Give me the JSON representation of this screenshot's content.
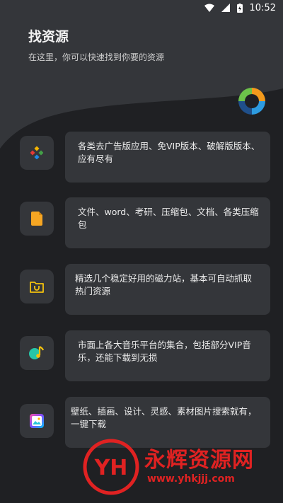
{
  "status": {
    "time": "10:52"
  },
  "header": {
    "title": "找资源",
    "subtitle": "在这里，你可以快速找到你要的资源"
  },
  "items": [
    {
      "icon": "apps-icon",
      "text": "各类去广告版应用、免VIP版本、破解版版本、应有尽有"
    },
    {
      "icon": "document-icon",
      "text": "文件、word、考研、压缩包、文档、各类压缩包"
    },
    {
      "icon": "magnet-folder-icon",
      "text": "精选几个稳定好用的磁力站，基本可自动抓取热门资源"
    },
    {
      "icon": "music-icon",
      "text": "市面上各大音乐平台的集合，包括部分VIP音乐，还能下载到无损"
    },
    {
      "icon": "image-icon",
      "text": "壁纸、插画、设计、灵感、素材图片搜索就有，一键下载"
    }
  ],
  "watermark": {
    "logo_text": "YH",
    "name": "永辉资源网",
    "url": "www.yhkjjj.com"
  }
}
